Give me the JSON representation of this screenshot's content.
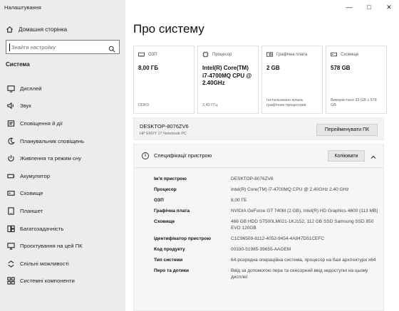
{
  "window": {
    "title": "Налаштування"
  },
  "sidebar": {
    "home_label": "Домашня сторінка",
    "search_placeholder": "Знайти настройку",
    "section_title": "Система",
    "items": [
      {
        "label": "Дисплей",
        "icon": "monitor-icon"
      },
      {
        "label": "Звук",
        "icon": "speaker-icon"
      },
      {
        "label": "Сповіщення й дії",
        "icon": "notification-icon"
      },
      {
        "label": "Планувальник сповіщень",
        "icon": "moon-icon"
      },
      {
        "label": "Живлення та режим сну",
        "icon": "power-icon"
      },
      {
        "label": "Акумулятор",
        "icon": "battery-icon"
      },
      {
        "label": "Сховище",
        "icon": "storage-icon"
      },
      {
        "label": "Планшет",
        "icon": "tablet-icon"
      },
      {
        "label": "Багатозадачність",
        "icon": "multitask-icon"
      },
      {
        "label": "Проєктування на цей ПК",
        "icon": "project-icon"
      },
      {
        "label": "Спільні можливості",
        "icon": "share-icon"
      },
      {
        "label": "Системні компоненти",
        "icon": "components-icon"
      }
    ]
  },
  "main": {
    "title": "Про систему",
    "cards": [
      {
        "label": "ОЗП",
        "icon": "ram-icon",
        "value": "8,00 ГБ",
        "sub": "DDR3"
      },
      {
        "label": "Процесор",
        "icon": "cpu-icon",
        "value": "Intel(R) Core(TM) i7-4700MQ CPU @ 2.40GHz",
        "sub": "2,40 ГГц"
      },
      {
        "label": "Графічна плата",
        "icon": "gpu-icon",
        "value": "2 GB",
        "sub": "Інстальовано кілька графічних процесорів"
      },
      {
        "label": "Сховище",
        "icon": "disk-icon",
        "value": "578 GB",
        "sub": "Використано 33 GB з 578 GB"
      }
    ],
    "device_name": "DESKTOP-8076ZV6",
    "device_model": "HP ENVY 17 Notebook PC",
    "rename_button": "Перейменувати ПК",
    "specs_title": "Специфікації пристрою",
    "copy_button": "Копіювати",
    "specs": [
      {
        "k": "Ім'я пристрою",
        "v": "DESKTOP-8076ZV6"
      },
      {
        "k": "Процесор",
        "v": "Intel(R) Core(TM) i7-4700MQ CPU @ 2.40GHz   2.40 GHz"
      },
      {
        "k": "ОЗП",
        "v": "8,00 ГБ"
      },
      {
        "k": "Графічна плата",
        "v": "NVIDIA GeForce GT 740M (2 GB), Intel(R) HD Graphics 4600 (113 MB)"
      },
      {
        "k": "Сховище",
        "v": "466 GB HDD ST500LM021-1KJ152, 112 GB SSD Samsung SSD 850 EVO 120GB"
      },
      {
        "k": "Ідентифікатор пристрою",
        "v": "C1C96509-8112-4052-9454-4A847D51CEFC"
      },
      {
        "k": "Код продукту",
        "v": "00330-51985-39655-AAOEM"
      },
      {
        "k": "Тип системи",
        "v": "64-розрядна операційна система, процесор на базі архітектури x64"
      },
      {
        "k": "Перо та дотики",
        "v": "Ввід за допомогою пера та сенсорний ввід недоступні на цьому дисплеї"
      }
    ]
  }
}
